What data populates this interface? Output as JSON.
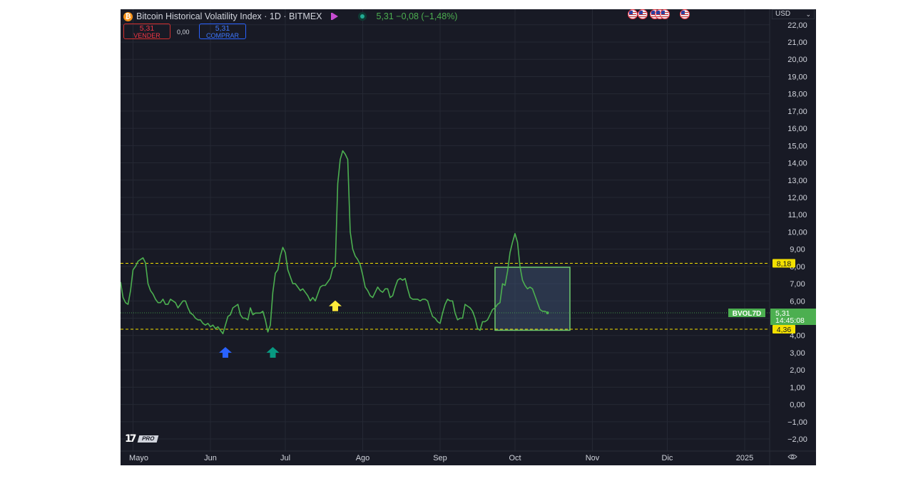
{
  "header": {
    "coin_symbol": "₿",
    "title": "Bitcoin Historical Volatility Index · 1D · BITMEX",
    "change": "5,31 −0,08 (−1,48%)"
  },
  "trade": {
    "sell_price": "5,31",
    "sell_label": "VENDER",
    "spread": "0,00",
    "buy_price": "5,31",
    "buy_label": "COMPRAR"
  },
  "currency": {
    "label": "USD",
    "chevron": "⌄"
  },
  "logo": {
    "mark": "17",
    "badge": "PRO"
  },
  "colors": {
    "background": "#181a25",
    "grid": "#252834",
    "line": "#4caf50",
    "level_lines": "#f3e000",
    "box_fill": "#3c4e6b",
    "box_stroke": "#6ecb6e",
    "arrow_blue": "#2962ff",
    "arrow_teal": "#089981",
    "arrow_yellow": "#ffeb3b"
  },
  "icons": [
    "bitcoin-icon",
    "flag-icon",
    "status-dot-icon",
    "settings-icon",
    "us-flag-event-icon",
    "arrow-up-icon"
  ],
  "chart_data": {
    "type": "line",
    "ylim": [
      -2.7,
      22.9
    ],
    "y_ticks": [
      -2,
      -1,
      0,
      1,
      2,
      3,
      4,
      5,
      6,
      7,
      8,
      9,
      10,
      11,
      12,
      13,
      14,
      15,
      16,
      17,
      18,
      19,
      20,
      21,
      22
    ],
    "y_tick_labels": [
      "−2,00",
      "−1,00",
      "0,00",
      "1,00",
      "2,00",
      "3,00",
      "4,00",
      "5,00",
      "6,00",
      "7,00",
      "8,00",
      "9,00",
      "10,00",
      "11,00",
      "12,00",
      "13,00",
      "14,00",
      "15,00",
      "16,00",
      "17,00",
      "18,00",
      "19,00",
      "20,00",
      "21,00",
      "22,00"
    ],
    "x_labels": [
      {
        "label": "Mayo",
        "day": 0
      },
      {
        "label": "Jun",
        "day": 31
      },
      {
        "label": "Jul",
        "day": 61
      },
      {
        "label": "Ago",
        "day": 92
      },
      {
        "label": "Sep",
        "day": 123
      },
      {
        "label": "Oct",
        "day": 153
      },
      {
        "label": "Nov",
        "day": 184
      },
      {
        "label": "Dic",
        "day": 214
      },
      {
        "label": "2025",
        "day": 245
      }
    ],
    "x_range_days": [
      -5,
      255
    ],
    "series": [
      {
        "name": "BVOL7D",
        "points": [
          [
            -5,
            7.1
          ],
          [
            -4,
            6.2
          ],
          [
            -3,
            5.9
          ],
          [
            -2,
            5.8
          ],
          [
            -1,
            6.6
          ],
          [
            0,
            7.8
          ],
          [
            1,
            8.0
          ],
          [
            2,
            8.3
          ],
          [
            3,
            8.4
          ],
          [
            4,
            8.5
          ],
          [
            5,
            8.2
          ],
          [
            6,
            7.0
          ],
          [
            7,
            6.6
          ],
          [
            8,
            6.4
          ],
          [
            9,
            6.1
          ],
          [
            10,
            5.9
          ],
          [
            11,
            5.9
          ],
          [
            12,
            6.1
          ],
          [
            13,
            5.8
          ],
          [
            14,
            5.8
          ],
          [
            15,
            6.1
          ],
          [
            16,
            6.0
          ],
          [
            17,
            5.9
          ],
          [
            18,
            5.6
          ],
          [
            19,
            5.8
          ],
          [
            20,
            6.0
          ],
          [
            21,
            6.0
          ],
          [
            22,
            5.6
          ],
          [
            23,
            5.3
          ],
          [
            24,
            5.2
          ],
          [
            25,
            5.0
          ],
          [
            26,
            4.9
          ],
          [
            27,
            4.9
          ],
          [
            28,
            4.7
          ],
          [
            29,
            4.6
          ],
          [
            30,
            4.7
          ],
          [
            31,
            4.5
          ],
          [
            32,
            4.6
          ],
          [
            33,
            4.4
          ],
          [
            34,
            4.5
          ],
          [
            35,
            4.3
          ],
          [
            36,
            4.1
          ],
          [
            37,
            4.6
          ],
          [
            38,
            5.1
          ],
          [
            39,
            5.2
          ],
          [
            40,
            5.6
          ],
          [
            41,
            5.7
          ],
          [
            42,
            5.8
          ],
          [
            43,
            5.2
          ],
          [
            44,
            5.0
          ],
          [
            45,
            5.0
          ],
          [
            46,
            4.9
          ],
          [
            47,
            5.6
          ],
          [
            48,
            5.2
          ],
          [
            49,
            5.3
          ],
          [
            50,
            5.3
          ],
          [
            51,
            5.3
          ],
          [
            52,
            5.4
          ],
          [
            53,
            4.9
          ],
          [
            54,
            4.2
          ],
          [
            55,
            4.6
          ],
          [
            56,
            6.5
          ],
          [
            57,
            7.6
          ],
          [
            58,
            7.8
          ],
          [
            59,
            8.6
          ],
          [
            60,
            9.1
          ],
          [
            61,
            8.8
          ],
          [
            62,
            7.8
          ],
          [
            63,
            7.4
          ],
          [
            64,
            7.0
          ],
          [
            65,
            7.0
          ],
          [
            66,
            6.8
          ],
          [
            67,
            6.6
          ],
          [
            68,
            6.7
          ],
          [
            69,
            6.5
          ],
          [
            70,
            6.3
          ],
          [
            71,
            6.0
          ],
          [
            72,
            6.2
          ],
          [
            73,
            6.0
          ],
          [
            74,
            6.4
          ],
          [
            75,
            6.8
          ],
          [
            76,
            6.9
          ],
          [
            77,
            6.9
          ],
          [
            78,
            7.1
          ],
          [
            79,
            7.3
          ],
          [
            80,
            7.9
          ],
          [
            81,
            8.0
          ],
          [
            82,
            12.8
          ],
          [
            83,
            14.2
          ],
          [
            84,
            14.7
          ],
          [
            85,
            14.5
          ],
          [
            86,
            14.2
          ],
          [
            87,
            10.0
          ],
          [
            88,
            9.0
          ],
          [
            89,
            8.6
          ],
          [
            90,
            8.4
          ],
          [
            91,
            8.1
          ],
          [
            92,
            7.5
          ],
          [
            93,
            6.8
          ],
          [
            94,
            6.6
          ],
          [
            95,
            6.3
          ],
          [
            96,
            6.2
          ],
          [
            97,
            6.5
          ],
          [
            98,
            6.8
          ],
          [
            99,
            6.6
          ],
          [
            100,
            6.5
          ],
          [
            101,
            6.7
          ],
          [
            102,
            6.7
          ],
          [
            103,
            6.2
          ],
          [
            104,
            6.3
          ],
          [
            105,
            6.8
          ],
          [
            106,
            7.2
          ],
          [
            107,
            7.3
          ],
          [
            108,
            7.2
          ],
          [
            109,
            7.3
          ],
          [
            110,
            6.7
          ],
          [
            111,
            6.2
          ],
          [
            112,
            6.1
          ],
          [
            113,
            6.1
          ],
          [
            114,
            6.1
          ],
          [
            115,
            6.0
          ],
          [
            116,
            6.1
          ],
          [
            117,
            6.1
          ],
          [
            118,
            6.0
          ],
          [
            119,
            5.5
          ],
          [
            120,
            5.1
          ],
          [
            121,
            5.0
          ],
          [
            122,
            4.8
          ],
          [
            123,
            4.7
          ],
          [
            124,
            5.3
          ],
          [
            125,
            5.8
          ],
          [
            126,
            6.1
          ],
          [
            127,
            6.0
          ],
          [
            128,
            6.0
          ],
          [
            129,
            5.3
          ],
          [
            130,
            4.9
          ],
          [
            131,
            5.0
          ],
          [
            132,
            5.0
          ],
          [
            133,
            5.8
          ],
          [
            134,
            5.7
          ],
          [
            135,
            5.6
          ],
          [
            136,
            5.4
          ],
          [
            137,
            5.0
          ],
          [
            138,
            4.4
          ],
          [
            139,
            4.3
          ],
          [
            140,
            4.8
          ],
          [
            141,
            4.8
          ],
          [
            142,
            4.9
          ],
          [
            143,
            5.2
          ],
          [
            144,
            5.5
          ],
          [
            145,
            5.6
          ],
          [
            146,
            5.8
          ],
          [
            147,
            5.9
          ],
          [
            148,
            7.0
          ],
          [
            149,
            6.9
          ],
          [
            150,
            7.7
          ],
          [
            151,
            8.8
          ],
          [
            152,
            9.4
          ],
          [
            153,
            9.9
          ],
          [
            154,
            9.4
          ],
          [
            155,
            8.0
          ],
          [
            156,
            7.2
          ],
          [
            157,
            6.9
          ],
          [
            158,
            6.7
          ],
          [
            159,
            6.8
          ],
          [
            160,
            6.7
          ],
          [
            161,
            6.3
          ],
          [
            162,
            5.9
          ],
          [
            163,
            5.5
          ],
          [
            164,
            5.4
          ],
          [
            165,
            5.4
          ],
          [
            166,
            5.31
          ]
        ]
      }
    ],
    "levels": [
      {
        "value": 8.18,
        "label": "8,18"
      },
      {
        "value": 4.36,
        "label": "4,36"
      }
    ],
    "current_value": {
      "label": "5,31",
      "countdown": "14:45:08",
      "series_tag": "BVOL7D"
    },
    "rectangle": {
      "x0": 145,
      "x1": 175,
      "y0": 4.3,
      "y1": 7.95
    },
    "arrows": [
      {
        "day": 37,
        "y": 3.0,
        "color": "blue"
      },
      {
        "day": 56,
        "y": 3.0,
        "color": "teal"
      },
      {
        "day": 81,
        "y": 5.7,
        "color": "yellow"
      }
    ],
    "event_days": [
      200,
      204,
      209,
      211,
      213,
      221
    ],
    "grid": true
  }
}
